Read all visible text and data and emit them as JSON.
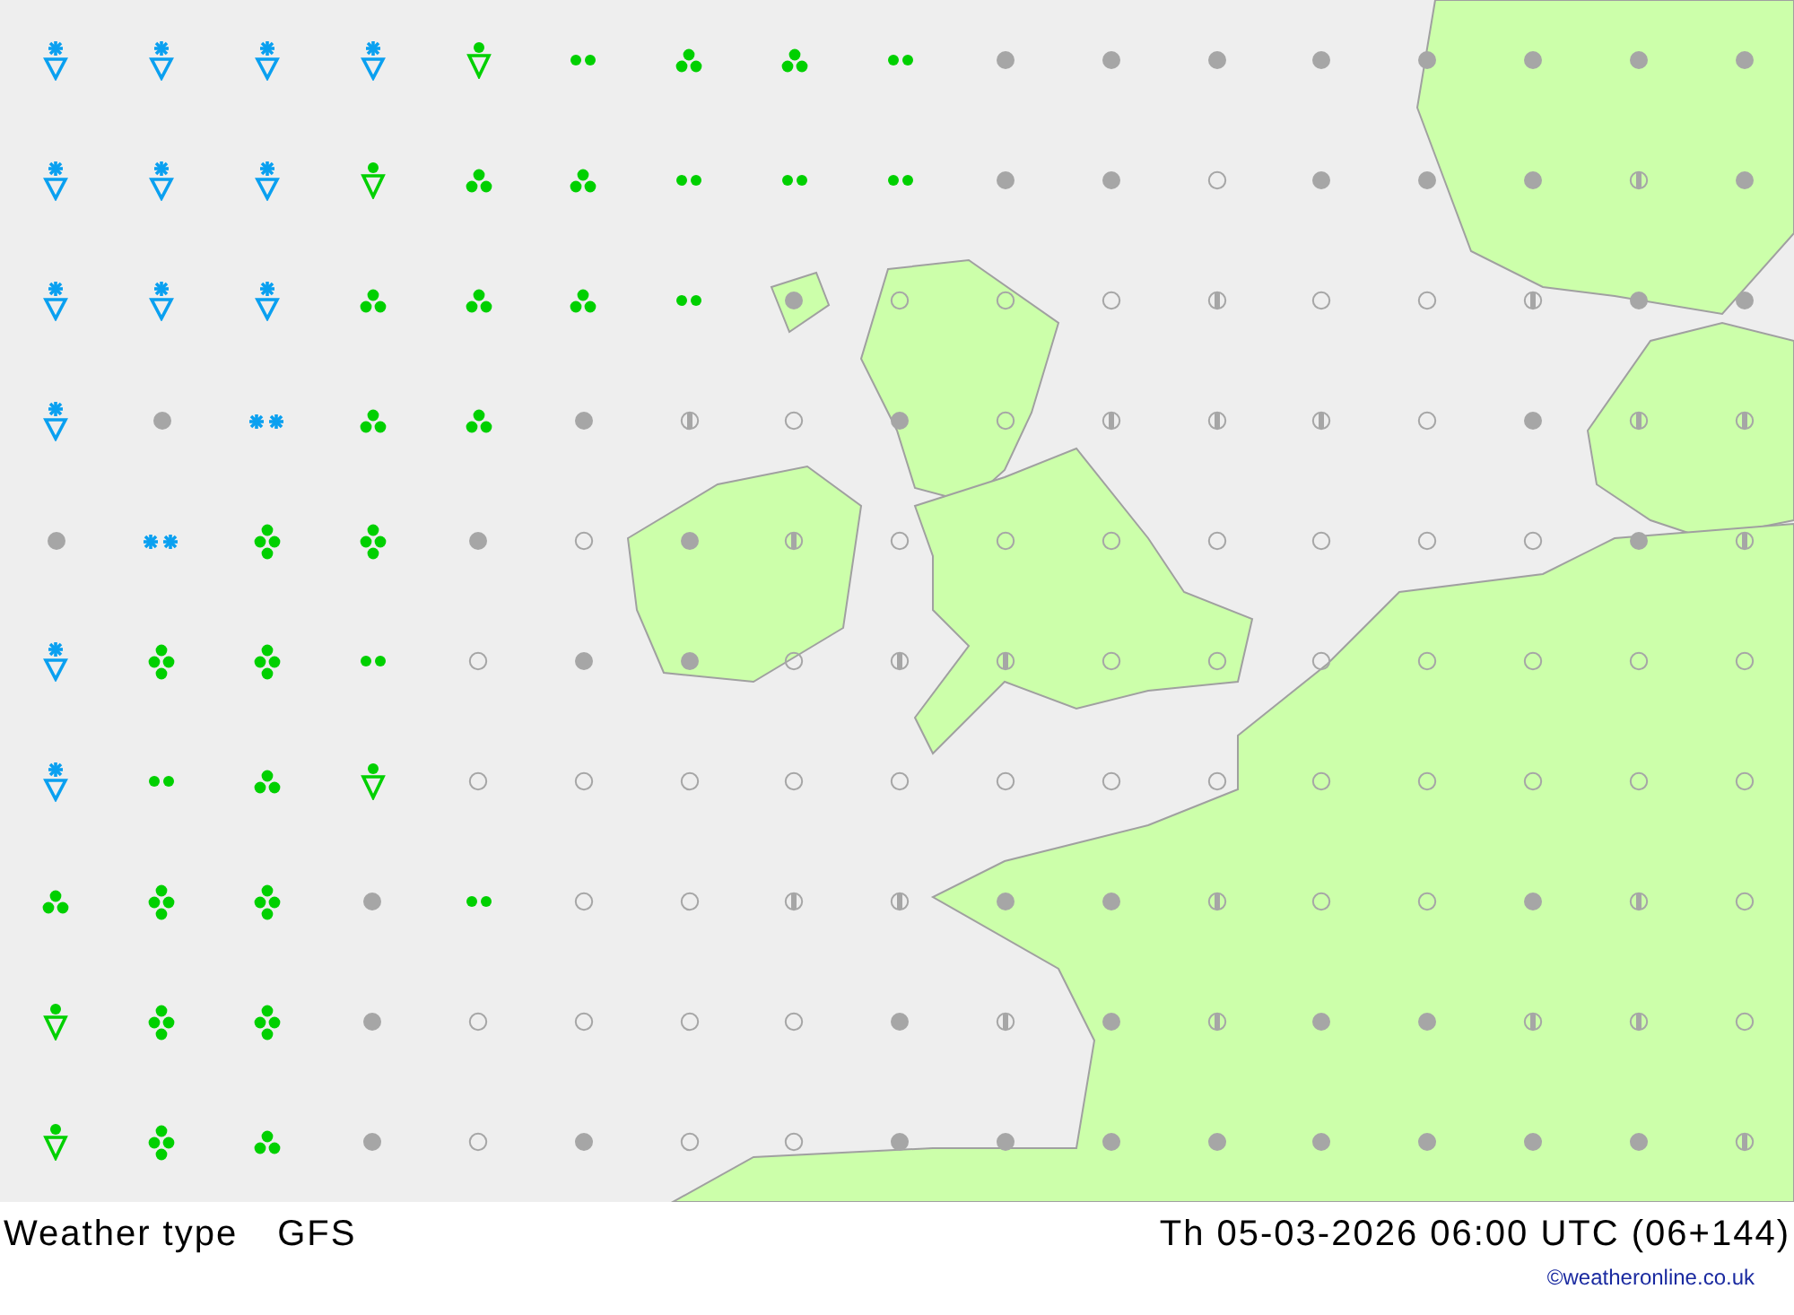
{
  "map": {
    "rows": [
      [
        {
          "kind": "snow_shower"
        },
        {
          "kind": "snow_shower"
        },
        {
          "kind": "snow_shower"
        },
        {
          "kind": "snow_shower"
        },
        {
          "kind": "rain_shower"
        },
        {
          "kind": "drizzle"
        },
        {
          "kind": "rain"
        },
        {
          "kind": "rain"
        },
        {
          "kind": "drizzle"
        },
        {
          "kind": "overcast"
        },
        {
          "kind": "overcast"
        },
        {
          "kind": "overcast"
        },
        {
          "kind": "overcast"
        },
        {
          "kind": "overcast"
        },
        {
          "kind": "overcast"
        },
        {
          "kind": "overcast"
        },
        {
          "kind": "overcast"
        }
      ],
      [
        {
          "kind": "snow_shower"
        },
        {
          "kind": "snow_shower"
        },
        {
          "kind": "snow_shower"
        },
        {
          "kind": "rain_shower"
        },
        {
          "kind": "rain"
        },
        {
          "kind": "rain"
        },
        {
          "kind": "drizzle"
        },
        {
          "kind": "drizzle"
        },
        {
          "kind": "drizzle"
        },
        {
          "kind": "overcast"
        },
        {
          "kind": "overcast"
        },
        {
          "kind": "clear"
        },
        {
          "kind": "overcast"
        },
        {
          "kind": "overcast"
        },
        {
          "kind": "overcast"
        },
        {
          "kind": "partly"
        },
        {
          "kind": "overcast"
        }
      ],
      [
        {
          "kind": "snow_shower"
        },
        {
          "kind": "snow_shower"
        },
        {
          "kind": "snow_shower"
        },
        {
          "kind": "rain"
        },
        {
          "kind": "rain"
        },
        {
          "kind": "rain"
        },
        {
          "kind": "drizzle"
        },
        {
          "kind": "overcast"
        },
        {
          "kind": "clear"
        },
        {
          "kind": "clear"
        },
        {
          "kind": "clear"
        },
        {
          "kind": "partly"
        },
        {
          "kind": "clear"
        },
        {
          "kind": "clear"
        },
        {
          "kind": "partly"
        },
        {
          "kind": "overcast"
        },
        {
          "kind": "overcast"
        }
      ],
      [
        {
          "kind": "snow_shower"
        },
        {
          "kind": "overcast"
        },
        {
          "kind": "snow"
        },
        {
          "kind": "rain"
        },
        {
          "kind": "rain"
        },
        {
          "kind": "overcast"
        },
        {
          "kind": "partly"
        },
        {
          "kind": "clear"
        },
        {
          "kind": "overcast"
        },
        {
          "kind": "clear"
        },
        {
          "kind": "partly"
        },
        {
          "kind": "partly"
        },
        {
          "kind": "partly"
        },
        {
          "kind": "clear"
        },
        {
          "kind": "overcast"
        },
        {
          "kind": "partly"
        },
        {
          "kind": "partly"
        }
      ],
      [
        {
          "kind": "overcast"
        },
        {
          "kind": "snow"
        },
        {
          "kind": "heavy_rain"
        },
        {
          "kind": "heavy_rain"
        },
        {
          "kind": "overcast"
        },
        {
          "kind": "clear"
        },
        {
          "kind": "overcast"
        },
        {
          "kind": "partly"
        },
        {
          "kind": "clear"
        },
        {
          "kind": "clear"
        },
        {
          "kind": "clear"
        },
        {
          "kind": "clear"
        },
        {
          "kind": "clear"
        },
        {
          "kind": "clear"
        },
        {
          "kind": "clear"
        },
        {
          "kind": "overcast"
        },
        {
          "kind": "partly"
        }
      ],
      [
        {
          "kind": "snow_shower"
        },
        {
          "kind": "heavy_rain"
        },
        {
          "kind": "heavy_rain"
        },
        {
          "kind": "drizzle"
        },
        {
          "kind": "clear"
        },
        {
          "kind": "overcast"
        },
        {
          "kind": "overcast"
        },
        {
          "kind": "clear"
        },
        {
          "kind": "partly"
        },
        {
          "kind": "partly"
        },
        {
          "kind": "clear"
        },
        {
          "kind": "clear"
        },
        {
          "kind": "clear"
        },
        {
          "kind": "clear"
        },
        {
          "kind": "clear"
        },
        {
          "kind": "clear"
        },
        {
          "kind": "clear"
        }
      ],
      [
        {
          "kind": "snow_shower"
        },
        {
          "kind": "drizzle"
        },
        {
          "kind": "rain"
        },
        {
          "kind": "rain_shower"
        },
        {
          "kind": "clear"
        },
        {
          "kind": "clear"
        },
        {
          "kind": "clear"
        },
        {
          "kind": "clear"
        },
        {
          "kind": "clear"
        },
        {
          "kind": "clear"
        },
        {
          "kind": "clear"
        },
        {
          "kind": "clear"
        },
        {
          "kind": "clear"
        },
        {
          "kind": "clear"
        },
        {
          "kind": "clear"
        },
        {
          "kind": "clear"
        },
        {
          "kind": "clear"
        }
      ],
      [
        {
          "kind": "rain"
        },
        {
          "kind": "heavy_rain"
        },
        {
          "kind": "heavy_rain"
        },
        {
          "kind": "overcast"
        },
        {
          "kind": "drizzle"
        },
        {
          "kind": "clear"
        },
        {
          "kind": "clear"
        },
        {
          "kind": "partly"
        },
        {
          "kind": "partly"
        },
        {
          "kind": "overcast"
        },
        {
          "kind": "overcast"
        },
        {
          "kind": "partly"
        },
        {
          "kind": "clear"
        },
        {
          "kind": "clear"
        },
        {
          "kind": "overcast"
        },
        {
          "kind": "partly"
        },
        {
          "kind": "clear"
        }
      ],
      [
        {
          "kind": "rain_shower"
        },
        {
          "kind": "heavy_rain"
        },
        {
          "kind": "heavy_rain"
        },
        {
          "kind": "overcast"
        },
        {
          "kind": "clear"
        },
        {
          "kind": "clear"
        },
        {
          "kind": "clear"
        },
        {
          "kind": "clear"
        },
        {
          "kind": "overcast"
        },
        {
          "kind": "partly"
        },
        {
          "kind": "overcast"
        },
        {
          "kind": "partly"
        },
        {
          "kind": "overcast"
        },
        {
          "kind": "overcast"
        },
        {
          "kind": "partly"
        },
        {
          "kind": "partly"
        },
        {
          "kind": "clear"
        }
      ],
      [
        {
          "kind": "rain_shower"
        },
        {
          "kind": "heavy_rain"
        },
        {
          "kind": "rain"
        },
        {
          "kind": "overcast"
        },
        {
          "kind": "clear"
        },
        {
          "kind": "overcast"
        },
        {
          "kind": "clear"
        },
        {
          "kind": "clear"
        },
        {
          "kind": "overcast"
        },
        {
          "kind": "overcast"
        },
        {
          "kind": "overcast"
        },
        {
          "kind": "overcast"
        },
        {
          "kind": "overcast"
        },
        {
          "kind": "overcast"
        },
        {
          "kind": "overcast"
        },
        {
          "kind": "overcast"
        },
        {
          "kind": "partly"
        }
      ]
    ]
  },
  "footer": {
    "title": "Weather type",
    "model": "GFS",
    "datetime": "Th 05-03-2026 06:00 UTC (06+144)",
    "credit": "©weatheronline.co.uk"
  }
}
